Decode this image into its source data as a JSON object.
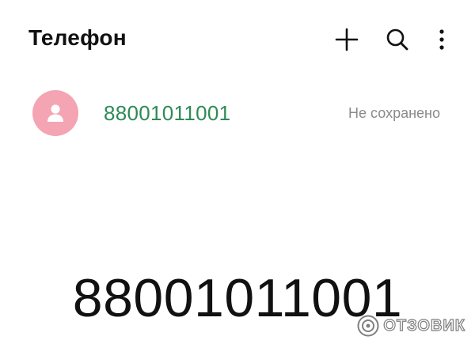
{
  "header": {
    "title": "Телефон",
    "actions": [
      {
        "name": "add-icon"
      },
      {
        "name": "search-icon"
      },
      {
        "name": "more-vert-icon"
      }
    ]
  },
  "recent_call": {
    "avatar_icon": "person-icon",
    "avatar_color": "#f4a4b3",
    "number": "88001011001",
    "number_color": "#2e8a56",
    "status": "Не сохранено"
  },
  "dialer": {
    "number": "88001011001"
  },
  "watermark": {
    "text": "ОТЗОВИК"
  }
}
